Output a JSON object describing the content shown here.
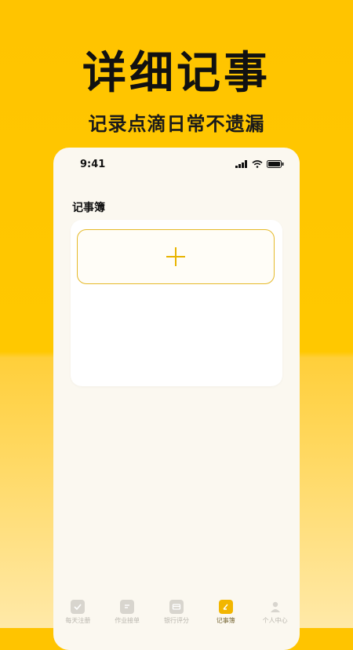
{
  "promo": {
    "headline": "详细记事",
    "subheadline": "记录点滴日常不遗漏"
  },
  "status_bar": {
    "time": "9:41"
  },
  "notebook": {
    "title": "记事簿",
    "add_icon": "plus-icon"
  },
  "tab_bar": {
    "items": [
      {
        "label": "每天注册",
        "icon": "checklist-icon",
        "active": false
      },
      {
        "label": "作业接单",
        "icon": "document-icon",
        "active": false
      },
      {
        "label": "银行评分",
        "icon": "bank-card-icon",
        "active": false
      },
      {
        "label": "记事簿",
        "icon": "notebook-icon",
        "active": true
      },
      {
        "label": "个人中心",
        "icon": "person-icon",
        "active": false
      }
    ]
  },
  "colors": {
    "accent": "#F2B600",
    "background_top": "#FFC400",
    "card_border": "#E5B928"
  }
}
